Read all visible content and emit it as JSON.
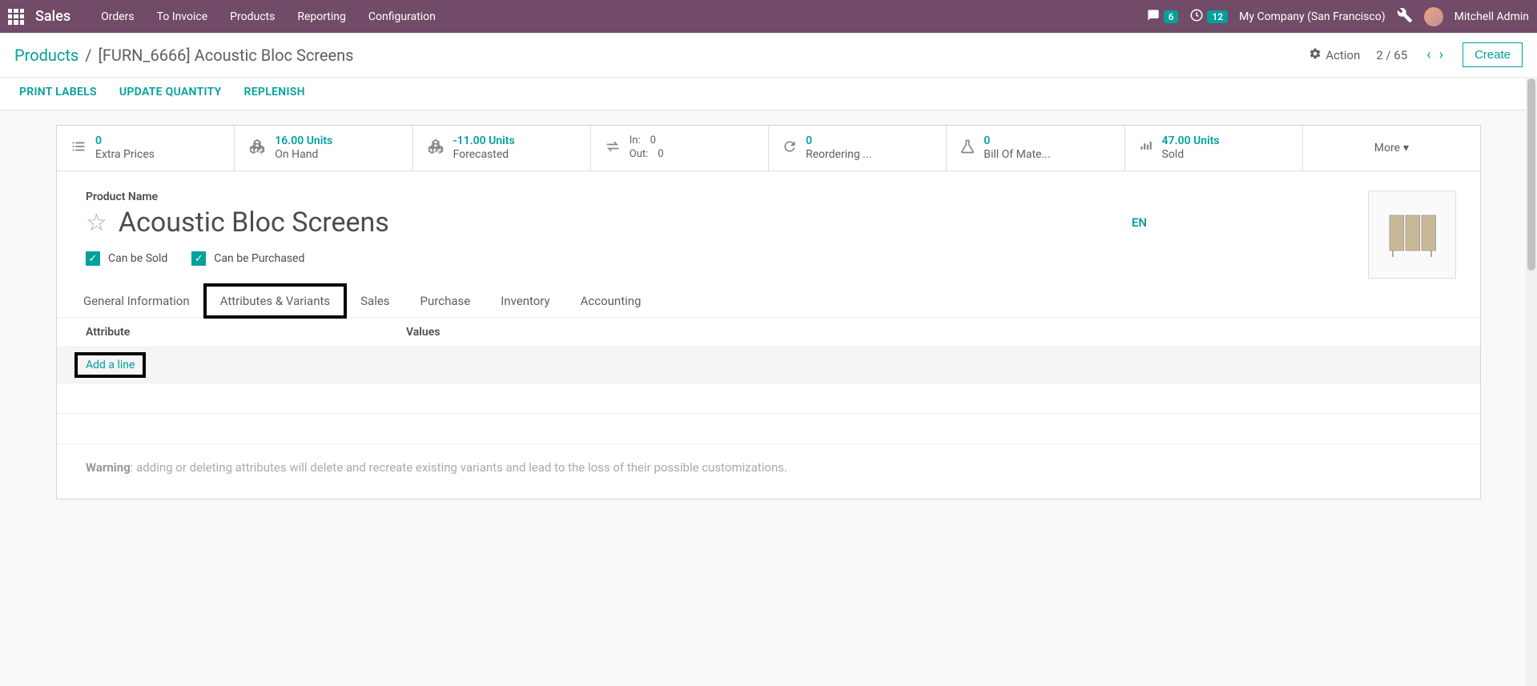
{
  "navbar": {
    "brand": "Sales",
    "items": [
      "Orders",
      "To Invoice",
      "Products",
      "Reporting",
      "Configuration"
    ],
    "chat_count": "6",
    "clock_count": "12",
    "company": "My Company (San Francisco)",
    "user": "Mitchell Admin"
  },
  "breadcrumb": {
    "root": "Products",
    "current": "[FURN_6666] Acoustic Bloc Screens"
  },
  "header": {
    "action": "Action",
    "pager": "2 / 65",
    "create": "Create"
  },
  "action_links": [
    "PRINT LABELS",
    "UPDATE QUANTITY",
    "REPLENISH"
  ],
  "stats": {
    "extra_prices": {
      "value": "0",
      "label": "Extra Prices"
    },
    "on_hand": {
      "value": "16.00 Units",
      "label": "On Hand"
    },
    "forecasted": {
      "value": "-11.00 Units",
      "label": "Forecasted"
    },
    "inout": {
      "in_label": "In:",
      "in_val": "0",
      "out_label": "Out:",
      "out_val": "0"
    },
    "reordering": {
      "value": "0",
      "label": "Reordering ..."
    },
    "bom": {
      "value": "0",
      "label": "Bill Of Mate..."
    },
    "sold": {
      "value": "47.00 Units",
      "label": "Sold"
    },
    "more": "More"
  },
  "product": {
    "name_label": "Product Name",
    "name": "Acoustic Bloc Screens",
    "lang": "EN",
    "can_sold": "Can be Sold",
    "can_purchased": "Can be Purchased"
  },
  "tabs": [
    "General Information",
    "Attributes & Variants",
    "Sales",
    "Purchase",
    "Inventory",
    "Accounting"
  ],
  "variants": {
    "col_attr": "Attribute",
    "col_values": "Values",
    "add_line": "Add a line"
  },
  "warning": {
    "label": "Warning",
    "text": ": adding or deleting attributes will delete and recreate existing variants and lead to the loss of their possible customizations."
  }
}
